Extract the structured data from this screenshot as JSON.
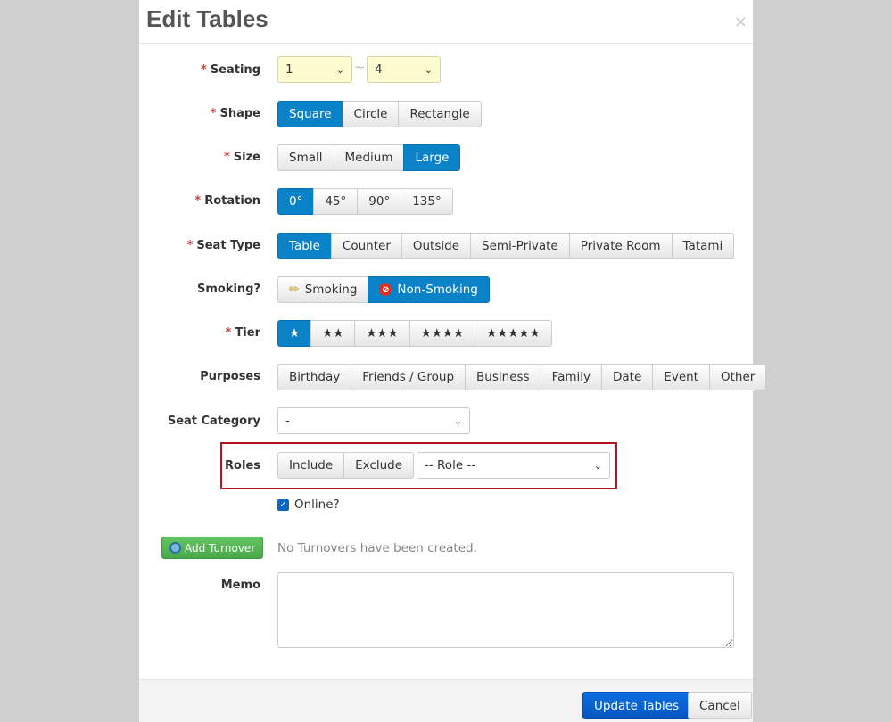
{
  "modal": {
    "title": "Edit Tables",
    "close_label": "×"
  },
  "required_marker": "*",
  "seating": {
    "label": "Seating",
    "min_value": "1",
    "separator": "~",
    "max_value": "4"
  },
  "shape": {
    "label": "Shape",
    "options": [
      "Square",
      "Circle",
      "Rectangle"
    ],
    "selected": "Square"
  },
  "size": {
    "label": "Size",
    "options": [
      "Small",
      "Medium",
      "Large"
    ],
    "selected": "Large"
  },
  "rotation": {
    "label": "Rotation",
    "options": [
      "0°",
      "45°",
      "90°",
      "135°"
    ],
    "selected": "0°"
  },
  "seat_type": {
    "label": "Seat Type",
    "options": [
      "Table",
      "Counter",
      "Outside",
      "Semi-Private",
      "Private Room",
      "Tatami"
    ],
    "selected": "Table"
  },
  "smoking": {
    "label": "Smoking?",
    "options": [
      "Smoking",
      "Non-Smoking"
    ],
    "selected": "Non-Smoking",
    "icons": [
      "pencil-icon",
      "no-smoking-icon"
    ]
  },
  "tier": {
    "label": "Tier",
    "options": [
      "★",
      "★★",
      "★★★",
      "★★★★",
      "★★★★★"
    ],
    "selected": "★"
  },
  "purposes": {
    "label": "Purposes",
    "options": [
      "Birthday",
      "Friends / Group",
      "Business",
      "Family",
      "Date",
      "Event",
      "Other"
    ]
  },
  "seat_category": {
    "label": "Seat Category",
    "value": "-"
  },
  "roles": {
    "label": "Roles",
    "include_label": "Include",
    "exclude_label": "Exclude",
    "role_value": "-- Role --",
    "highlight_color": "#b3121e"
  },
  "online": {
    "label": "Online?",
    "checked": true
  },
  "turnover": {
    "button_label": "Add Turnover",
    "empty_text": "No Turnovers have been created."
  },
  "memo": {
    "label": "Memo",
    "value": ""
  },
  "footer": {
    "submit_label": "Update Tables",
    "cancel_label": "Cancel"
  },
  "colors": {
    "active": "#0a82c8",
    "primary": "#0455c0",
    "success": "#4aa84a",
    "required": "#b94a48"
  }
}
